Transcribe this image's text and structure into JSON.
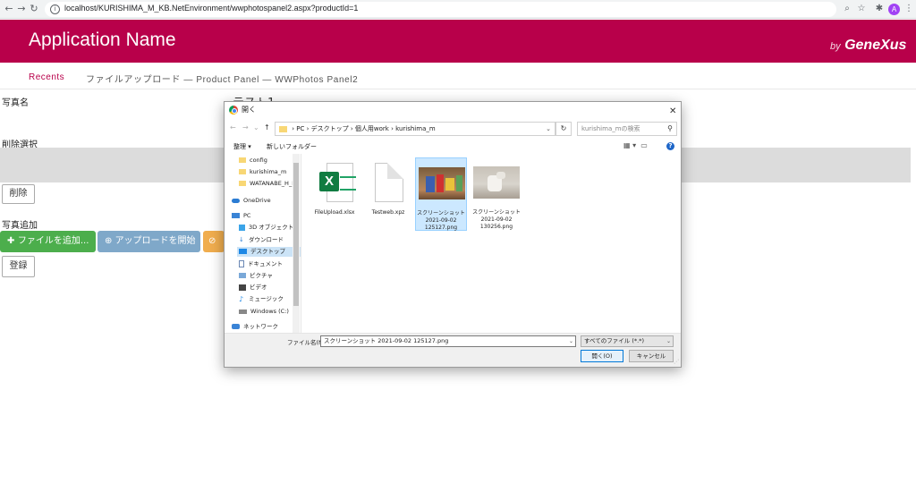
{
  "browser": {
    "url": "localhost/KURISHIMA_M_KB.NetEnvironment/wwphotospanel2.aspx?productId=1",
    "avatar_letter": "A"
  },
  "header": {
    "app_title": "Application Name",
    "brand_by": "by",
    "brand_name": "GeneXus",
    "color": "#b8004a"
  },
  "breadcrumb": {
    "recents": "Recents",
    "path": "ファイルアップロード — Product Panel — WWPhotos Panel2"
  },
  "form": {
    "photo_name_label": "写真名",
    "photo_name_value": "テスト1",
    "delete_select_label": "削除選択",
    "delete_button": "削除",
    "add_photo_label": "写真追加",
    "add_file_button": "ファイルを追加...",
    "start_upload_button": "アップロードを開始",
    "register_button": "登録"
  },
  "dialog": {
    "title": "開く",
    "path": [
      "PC",
      "デスクトップ",
      "個人用work",
      "kurishima_m"
    ],
    "search_placeholder": "kurishima_mの検索",
    "organize": "整理 ▾",
    "new_folder": "新しいフォルダー",
    "nav_items": [
      {
        "label": "config",
        "icon": "folder-icon"
      },
      {
        "label": "kurishima_m",
        "icon": "folder-icon"
      },
      {
        "label": "WATANABE_H_K",
        "icon": "folder-icon"
      },
      {
        "label": "OneDrive",
        "icon": "onedrive-icon"
      },
      {
        "label": "PC",
        "icon": "pc-icon"
      },
      {
        "label": "3D オブジェクト",
        "icon": "3d-objects-icon"
      },
      {
        "label": "ダウンロード",
        "icon": "download-icon"
      },
      {
        "label": "デスクトップ",
        "icon": "desktop-icon"
      },
      {
        "label": "ドキュメント",
        "icon": "documents-icon"
      },
      {
        "label": "ピクチャ",
        "icon": "pictures-icon"
      },
      {
        "label": "ビデオ",
        "icon": "videos-icon"
      },
      {
        "label": "ミュージック",
        "icon": "music-icon"
      },
      {
        "label": "Windows (C:)",
        "icon": "drive-icon"
      },
      {
        "label": "ネットワーク",
        "icon": "network-icon"
      }
    ],
    "files": [
      {
        "line1": "FileUpload.xlsx",
        "line2": "",
        "line3": ""
      },
      {
        "line1": "Testweb.xpz",
        "line2": "",
        "line3": ""
      },
      {
        "line1": "スクリーンショット",
        "line2": "2021-09-02",
        "line3": "125127.png"
      },
      {
        "line1": "スクリーンショット",
        "line2": "2021-09-02",
        "line3": "130256.png"
      }
    ],
    "filename_label": "ファイル名(N):",
    "filename_value": "スクリーンショット 2021-09-02 125127.png",
    "filetype_value": "すべてのファイル (*.*)",
    "open_button": "開く(O)",
    "cancel_button": "キャンセル"
  }
}
